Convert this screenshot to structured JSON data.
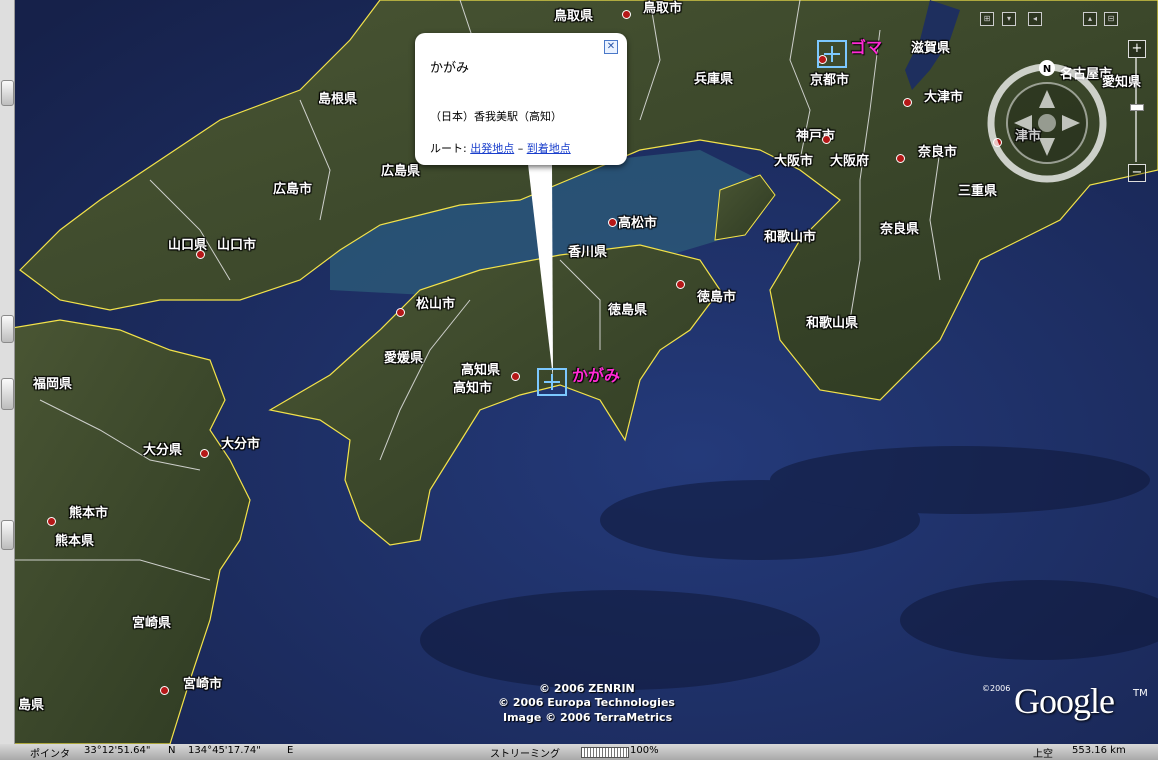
{
  "map": {
    "places": [
      {
        "id": "tottori-ken",
        "label": "鳥取県"
      },
      {
        "id": "tottori-shi",
        "label": "鳥取市"
      },
      {
        "id": "shimane-ken",
        "label": "島根県"
      },
      {
        "id": "hyogo-ken",
        "label": "兵庫県"
      },
      {
        "id": "kyoto-shi",
        "label": "京都市"
      },
      {
        "id": "shiga-ken",
        "label": "滋賀県"
      },
      {
        "id": "otsu-shi",
        "label": "大津市"
      },
      {
        "id": "nagoya-shi",
        "label": "名古屋市"
      },
      {
        "id": "aichi-ken",
        "label": "愛知県"
      },
      {
        "id": "tsu-shi",
        "label": "津市"
      },
      {
        "id": "kobe-shi",
        "label": "神戸市"
      },
      {
        "id": "osaka-shi",
        "label": "大阪市"
      },
      {
        "id": "osaka-fu",
        "label": "大阪府"
      },
      {
        "id": "nara-shi",
        "label": "奈良市"
      },
      {
        "id": "mie-ken",
        "label": "三重県"
      },
      {
        "id": "hiroshima-shi",
        "label": "広島市"
      },
      {
        "id": "hiroshima-ken",
        "label": "広島県"
      },
      {
        "id": "yamaguchi-ken",
        "label": "山口県"
      },
      {
        "id": "yamaguchi-shi",
        "label": "山口市"
      },
      {
        "id": "takamatsu-shi",
        "label": "高松市"
      },
      {
        "id": "kagawa-ken",
        "label": "香川県"
      },
      {
        "id": "wakayama-shi",
        "label": "和歌山市"
      },
      {
        "id": "nara-ken",
        "label": "奈良県"
      },
      {
        "id": "matsuyama-shi",
        "label": "松山市"
      },
      {
        "id": "tokushima-ken",
        "label": "徳島県"
      },
      {
        "id": "tokushima-shi",
        "label": "徳島市"
      },
      {
        "id": "wakayama-ken",
        "label": "和歌山県"
      },
      {
        "id": "ehime-ken",
        "label": "愛媛県"
      },
      {
        "id": "kochi-ken",
        "label": "高知県"
      },
      {
        "id": "kochi-shi",
        "label": "高知市"
      },
      {
        "id": "fukuoka-ken",
        "label": "福岡県"
      },
      {
        "id": "oita-ken",
        "label": "大分県"
      },
      {
        "id": "oita-shi",
        "label": "大分市"
      },
      {
        "id": "kumamoto-shi",
        "label": "熊本市"
      },
      {
        "id": "kumamoto-ken",
        "label": "熊本県"
      },
      {
        "id": "miyazaki-ken",
        "label": "宮崎県"
      },
      {
        "id": "miyazaki-shi",
        "label": "宮崎市"
      },
      {
        "id": "kagoshima-ken-partial",
        "label": "島県"
      }
    ],
    "placemarks": {
      "goma": "ゴマ",
      "kagami": "かがみ"
    }
  },
  "balloon": {
    "title": "かがみ",
    "description": "（日本）香我美駅（高知）",
    "route_prefix": "ルート: ",
    "route_from": "出発地点",
    "route_sep": " – ",
    "route_to": "到着地点",
    "close_symbol": "✕"
  },
  "navigation": {
    "north_label": "N",
    "zoom_in": "+",
    "zoom_out": "−"
  },
  "copyright": [
    "© 2006 ZENRIN",
    "© 2006 Europa Technologies",
    "Image © 2006 TerraMetrics"
  ],
  "logo": {
    "year": "©2006",
    "text": "Google",
    "tm": "TM"
  },
  "status": {
    "pointer_label": "ポインタ",
    "pointer_lat": "33°12'51.64\"",
    "lat_dir": "N",
    "pointer_lon": "134°45'17.74\"",
    "lon_dir": "E",
    "streaming_label": "ストリーミング",
    "streaming_percent": "100%",
    "altitude_label": "上空",
    "altitude_value": "553.16 km"
  },
  "colors": {
    "sea": "#1c2a5c",
    "land": "#3c4a2c",
    "border": "#e6e6e6",
    "coast": "#f2e24a",
    "placemark_label": "#ff2ad4",
    "city_dot": "#b51818"
  }
}
